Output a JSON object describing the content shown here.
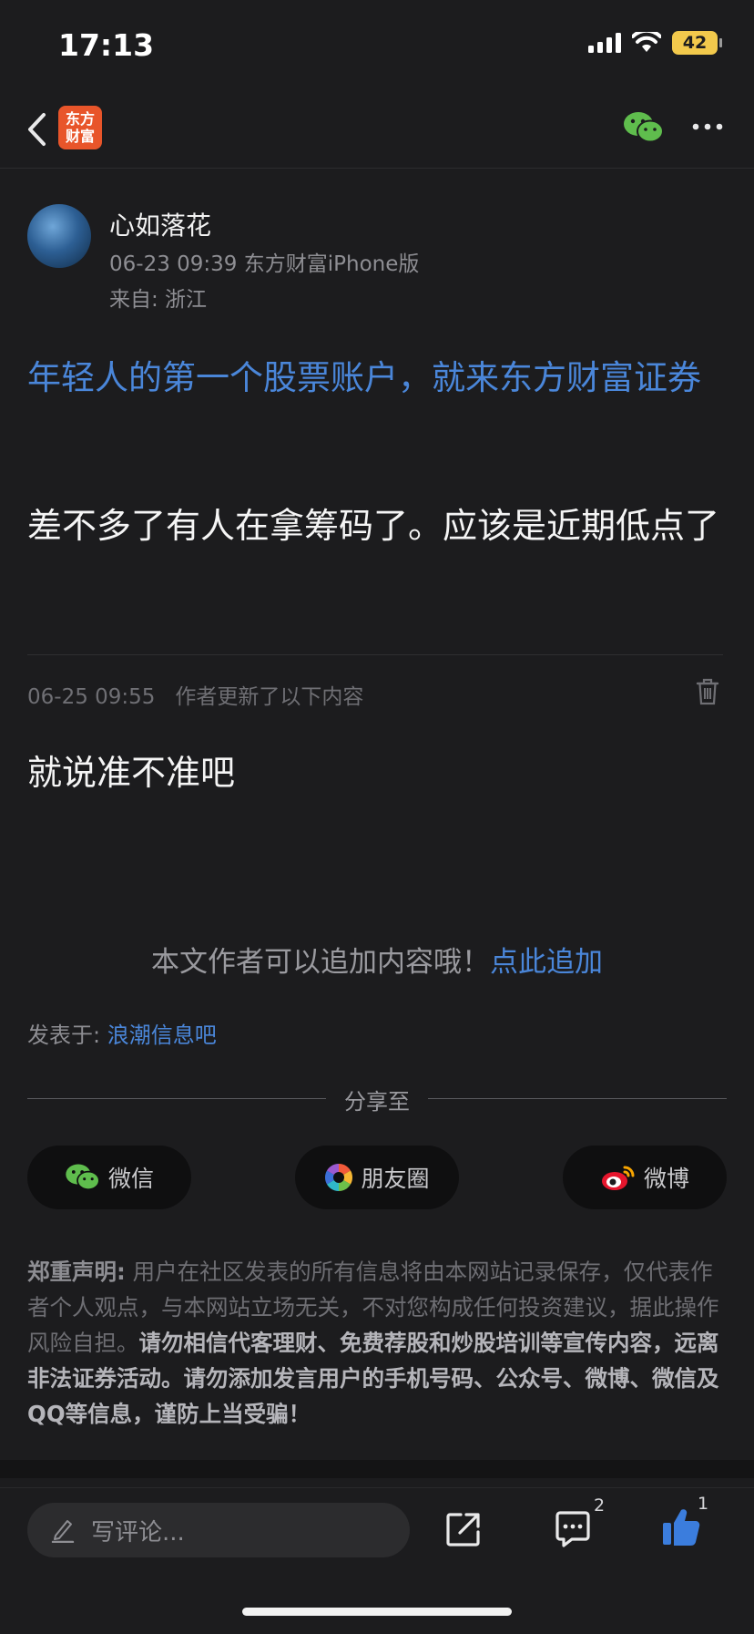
{
  "status_bar": {
    "time": "17:13",
    "battery": "42"
  },
  "header": {
    "logo_line1": "东方",
    "logo_line2": "财富"
  },
  "post": {
    "author": "心如落花",
    "meta": "06-23 09:39  东方财富iPhone版",
    "location": "来自: 浙江",
    "promo_link": "年轻人的第一个股票账户，就来东方财富证券",
    "body": "差不多了有人在拿筹码了。应该是近期低点了"
  },
  "update": {
    "timestamp": "06-25 09:55",
    "label": "作者更新了以下内容",
    "body": "就说准不准吧"
  },
  "append": {
    "text": "本文作者可以追加内容哦！",
    "link": "点此追加"
  },
  "posted_in": {
    "prefix": "发表于:",
    "forum": "浪潮信息吧"
  },
  "share": {
    "label": "分享至",
    "buttons": [
      "微信",
      "朋友圈",
      "微博"
    ]
  },
  "disclaimer": {
    "title": "郑重声明:",
    "normal": "用户在社区发表的所有信息将由本网站记录保存，仅代表作者个人观点，与本网站立场无关，不对您构成任何投资建议，据此操作风险自担。",
    "strong": "请勿相信代客理财、免费荐股和炒股培训等宣传内容，远离非法证券活动。请勿添加发言用户的手机号码、公众号、微博、微信及QQ等信息，谨防上当受骗！"
  },
  "bottom_bar": {
    "comment_placeholder": "写评论...",
    "comment_count": "2",
    "like_count": "1"
  },
  "colors": {
    "accent": "#4a86d9",
    "background": "#1c1c1e",
    "brand": "#e8552a"
  }
}
